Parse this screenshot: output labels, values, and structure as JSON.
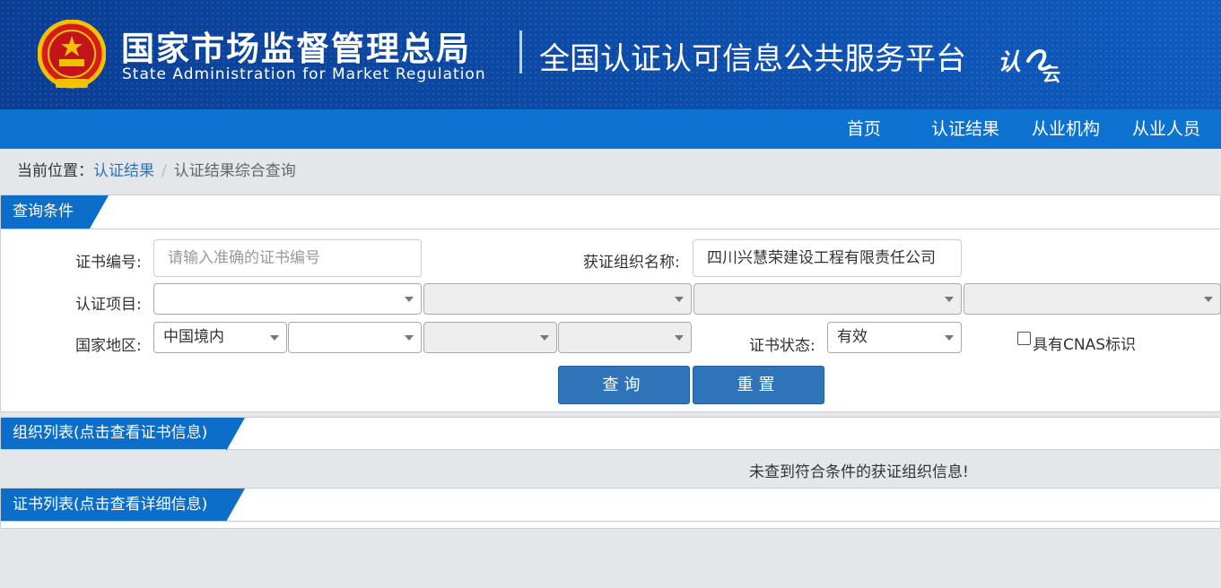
{
  "header": {
    "org_name_cn": "国家市场监督管理总局",
    "org_name_en": "State Administration  for  Market Regulation",
    "platform_title": "全国认证认可信息公共服务平台",
    "logo_text_1": "认",
    "logo_text_2": "云",
    "colors": {
      "banner": "#0c4aa6",
      "nav": "#0e72d0",
      "accent": "#2f73b8"
    }
  },
  "nav": {
    "items": [
      {
        "label": "首页"
      },
      {
        "label": "认证结果"
      },
      {
        "label": "从业机构"
      },
      {
        "label": "从业人员"
      }
    ]
  },
  "breadcrumb": {
    "prefix": "当前位置：",
    "link": "认证结果",
    "separator": "/",
    "current": "认证结果综合查询"
  },
  "query_panel": {
    "title": "查询条件",
    "cert_no": {
      "label": "证书编号:",
      "placeholder": "请输入准确的证书编号",
      "value": ""
    },
    "org_name": {
      "label": "获证组织名称:",
      "value": "四川兴慧荣建设工程有限责任公司"
    },
    "cert_project": {
      "label": "认证项目:",
      "selects": [
        "",
        "",
        "",
        ""
      ]
    },
    "region": {
      "label": "国家地区:",
      "selects": [
        "中国境内",
        "",
        "",
        ""
      ]
    },
    "status": {
      "label": "证书状态:",
      "value": "有效"
    },
    "cnas": {
      "label": "具有CNAS标识",
      "checked": false
    },
    "search_button": "查询",
    "reset_button": "重置"
  },
  "org_list_panel": {
    "title": "组织列表(点击查看证书信息)",
    "empty_message": "未查到符合条件的获证组织信息!"
  },
  "cert_list_panel": {
    "title": "证书列表(点击查看详细信息)"
  }
}
